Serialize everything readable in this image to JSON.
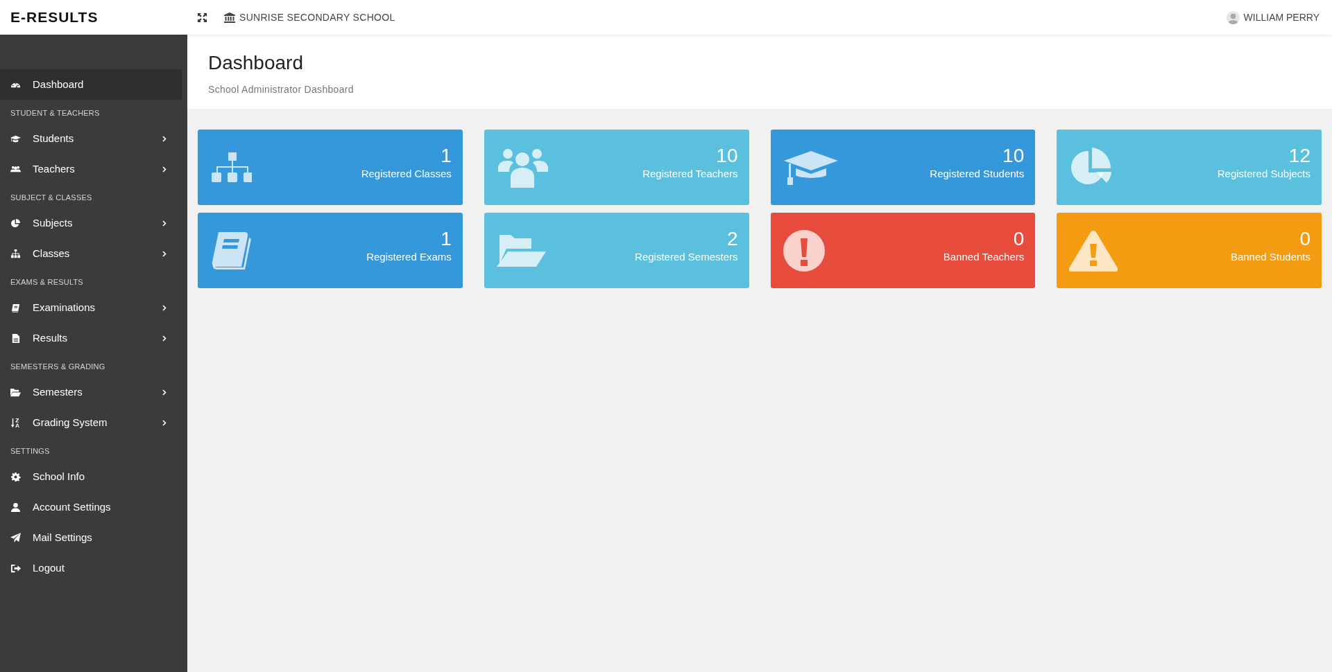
{
  "header": {
    "brand": "E-RESULTS",
    "school": "SUNRISE SECONDARY SCHOOL",
    "user": "WILLIAM PERRY"
  },
  "sidebar": {
    "items": [
      {
        "kind": "item",
        "label": "Dashboard",
        "selected": true,
        "submenu": false
      },
      {
        "kind": "section",
        "label": "STUDENT & TEACHERS"
      },
      {
        "kind": "item",
        "label": "Students",
        "selected": false,
        "submenu": true
      },
      {
        "kind": "item",
        "label": "Teachers",
        "selected": false,
        "submenu": true
      },
      {
        "kind": "section",
        "label": "SUBJECT & CLASSES"
      },
      {
        "kind": "item",
        "label": "Subjects",
        "selected": false,
        "submenu": true
      },
      {
        "kind": "item",
        "label": "Classes",
        "selected": false,
        "submenu": true
      },
      {
        "kind": "section",
        "label": "EXAMS & RESULTS"
      },
      {
        "kind": "item",
        "label": "Examinations",
        "selected": false,
        "submenu": true
      },
      {
        "kind": "item",
        "label": "Results",
        "selected": false,
        "submenu": true
      },
      {
        "kind": "section",
        "label": "SEMESTERS & GRADING"
      },
      {
        "kind": "item",
        "label": "Semesters",
        "selected": false,
        "submenu": true
      },
      {
        "kind": "item",
        "label": "Grading System",
        "selected": false,
        "submenu": true
      },
      {
        "kind": "section",
        "label": "SETTINGS"
      },
      {
        "kind": "item",
        "label": "School Info",
        "selected": false,
        "submenu": false
      },
      {
        "kind": "item",
        "label": "Account Settings",
        "selected": false,
        "submenu": false
      },
      {
        "kind": "item",
        "label": "Mail Settings",
        "selected": false,
        "submenu": false
      },
      {
        "kind": "item",
        "label": "Logout",
        "selected": false,
        "submenu": false
      }
    ]
  },
  "page": {
    "title": "Dashboard",
    "subtitle": "School Administrator Dashboard"
  },
  "cards": [
    {
      "value": "1",
      "label": "Registered Classes",
      "color": "#3498db"
    },
    {
      "value": "10",
      "label": "Registered Teachers",
      "color": "#5bc0de"
    },
    {
      "value": "10",
      "label": "Registered Students",
      "color": "#3498db"
    },
    {
      "value": "12",
      "label": "Registered Subjects",
      "color": "#5bc0de"
    },
    {
      "value": "1",
      "label": "Registered Exams",
      "color": "#3498db"
    },
    {
      "value": "2",
      "label": "Registered Semesters",
      "color": "#5bc0de"
    },
    {
      "value": "0",
      "label": "Banned Teachers",
      "color": "#e74c3c"
    },
    {
      "value": "0",
      "label": "Banned Students",
      "color": "#f39c12"
    }
  ]
}
